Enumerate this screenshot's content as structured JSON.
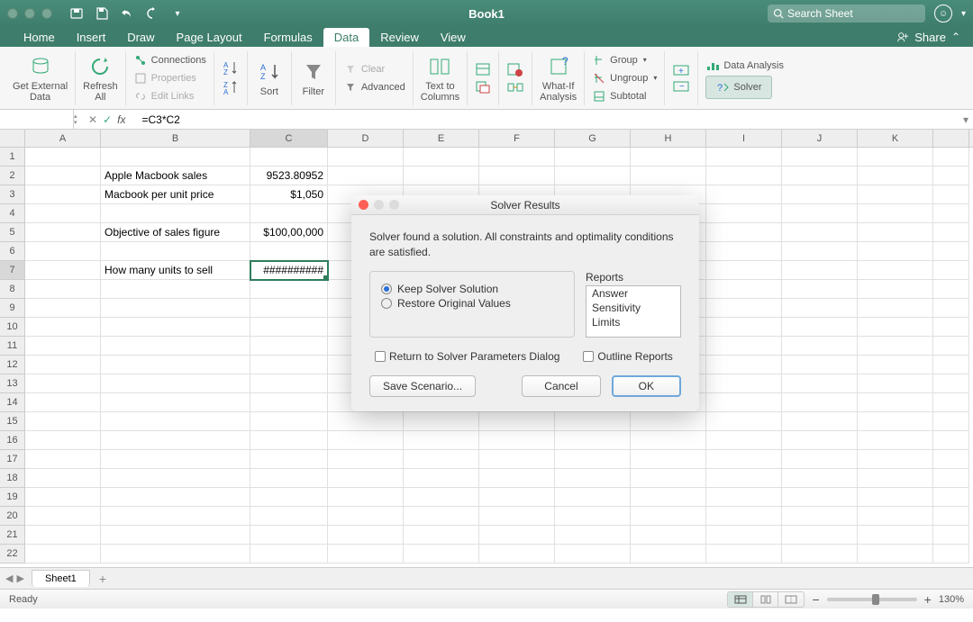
{
  "title": "Book1",
  "search_placeholder": "Search Sheet",
  "menu": {
    "home": "Home",
    "insert": "Insert",
    "draw": "Draw",
    "page_layout": "Page Layout",
    "formulas": "Formulas",
    "data": "Data",
    "review": "Review",
    "view": "View",
    "share": "Share"
  },
  "ribbon": {
    "get_external": "Get External\nData",
    "refresh": "Refresh\nAll",
    "connections": "Connections",
    "properties": "Properties",
    "edit_links": "Edit Links",
    "sort": "Sort",
    "filter": "Filter",
    "clear": "Clear",
    "advanced": "Advanced",
    "text_to_columns": "Text to\nColumns",
    "whatif": "What-If\nAnalysis",
    "group": "Group",
    "ungroup": "Ungroup",
    "subtotal": "Subtotal",
    "data_analysis": "Data Analysis",
    "solver": "Solver"
  },
  "name_box": "",
  "formula": "=C3*C2",
  "columns": [
    "A",
    "B",
    "C",
    "D",
    "E",
    "F",
    "G",
    "H",
    "I",
    "J",
    "K"
  ],
  "rows": [
    "1",
    "2",
    "3",
    "4",
    "5",
    "6",
    "7",
    "8",
    "9",
    "10",
    "11",
    "12",
    "13",
    "14",
    "15",
    "16",
    "17",
    "18",
    "19",
    "20",
    "21",
    "22"
  ],
  "cells": {
    "B2": "Apple Macbook sales",
    "C2": "9523.80952",
    "B3": "Macbook per unit price",
    "C3": "$1,050",
    "B5": "Objective of sales figure",
    "C5": "$100,00,000",
    "B7": "How many units to sell",
    "C7": "##########"
  },
  "active_cell": "C7",
  "sheet_tab": "Sheet1",
  "status": "Ready",
  "zoom": "130%",
  "dialog": {
    "title": "Solver Results",
    "message": "Solver found a solution.  All constraints and optimality conditions are satisfied.",
    "keep": "Keep Solver Solution",
    "restore": "Restore Original Values",
    "reports_label": "Reports",
    "reports": [
      "Answer",
      "Sensitivity",
      "Limits"
    ],
    "return_chk": "Return to Solver Parameters Dialog",
    "outline_chk": "Outline Reports",
    "save_scenario": "Save Scenario...",
    "cancel": "Cancel",
    "ok": "OK"
  }
}
